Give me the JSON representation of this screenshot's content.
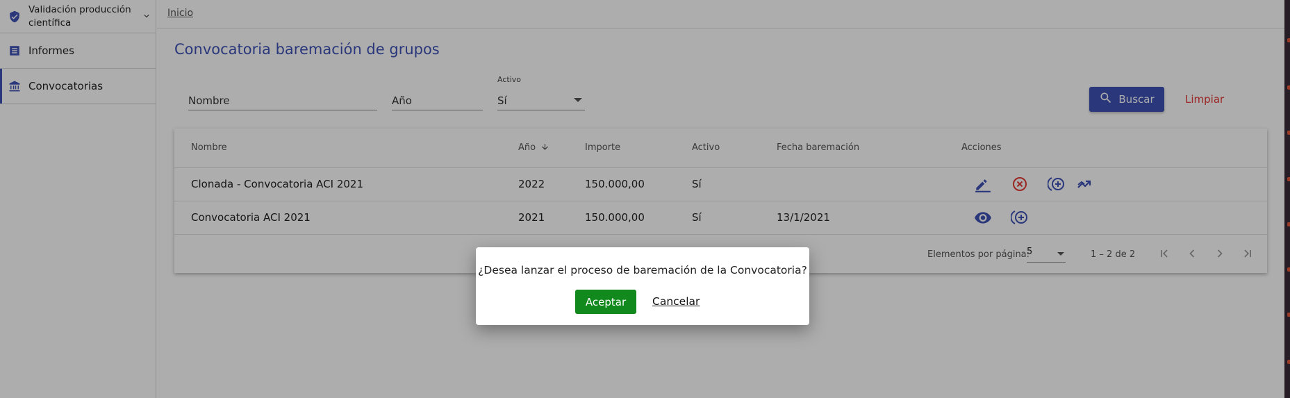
{
  "sidebar": {
    "module": {
      "label_line1": "Validación producción",
      "label_line2": "científica"
    },
    "items": [
      {
        "label": "Informes"
      },
      {
        "label": "Convocatorias"
      }
    ]
  },
  "breadcrumb": {
    "home": "Inicio"
  },
  "page": {
    "title": "Convocatoria baremación de grupos"
  },
  "filters": {
    "nombre_placeholder": "Nombre",
    "anio_placeholder": "Año",
    "activo_label": "Activo",
    "activo_value": "Sí",
    "search_label": "Buscar",
    "clear_label": "Limpiar"
  },
  "table": {
    "columns": [
      "Nombre",
      "Año",
      "Importe",
      "Activo",
      "Fecha baremación",
      "Acciones"
    ],
    "rows": [
      {
        "nombre": "Clonada - Convocatoria ACI 2021",
        "anio": "2022",
        "importe": "150.000,00",
        "activo": "Sí",
        "fecha": "",
        "actions": [
          "edit-icon",
          "cancel-icon",
          "add-circle-icon",
          "trending-icon"
        ]
      },
      {
        "nombre": "Convocatoria ACI 2021",
        "anio": "2021",
        "importe": "150.000,00",
        "activo": "Sí",
        "fecha": "13/1/2021",
        "actions": [
          "view-icon",
          "add-circle-icon"
        ]
      }
    ]
  },
  "paginator": {
    "items_per_page_label": "Elementos por página:",
    "page_size": "5",
    "range": "1 – 2 de 2"
  },
  "dialog": {
    "message": "¿Desea lanzar el proceso de baremación de la Convocatoria?",
    "accept_label": "Aceptar",
    "cancel_label": "Cancelar"
  },
  "colors": {
    "primary": "#3f51b5",
    "warn": "#e53935",
    "accept": "#12891c"
  }
}
